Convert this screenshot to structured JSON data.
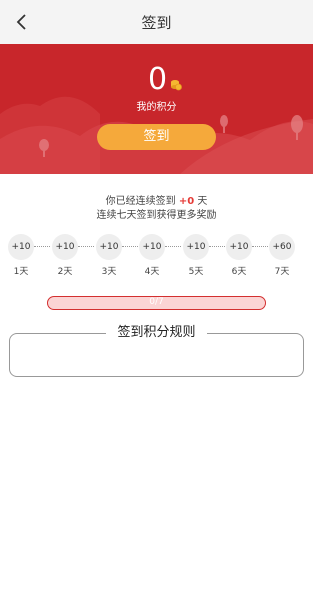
{
  "header": {
    "title": "签到",
    "back_icon": "chevron-left-icon"
  },
  "banner": {
    "background_color": "#c8262b",
    "points_value": "0",
    "coin_icon": "coin-icon",
    "points_label": "我的积分",
    "sign_button_label": "签到",
    "button_color": "#f5a93b"
  },
  "streak": {
    "prefix": "你已经连续签到",
    "count": "+0",
    "suffix": "天",
    "hint": "连续七天签到获得更多奖励"
  },
  "days": [
    {
      "reward": "+10",
      "label": "1天"
    },
    {
      "reward": "+10",
      "label": "2天"
    },
    {
      "reward": "+10",
      "label": "3天"
    },
    {
      "reward": "+10",
      "label": "4天"
    },
    {
      "reward": "+10",
      "label": "5天"
    },
    {
      "reward": "+10",
      "label": "6天"
    },
    {
      "reward": "+60",
      "label": "7天"
    }
  ],
  "progress": {
    "text": "0/7",
    "fraction": 0
  },
  "rules": {
    "title": "签到积分规则"
  }
}
